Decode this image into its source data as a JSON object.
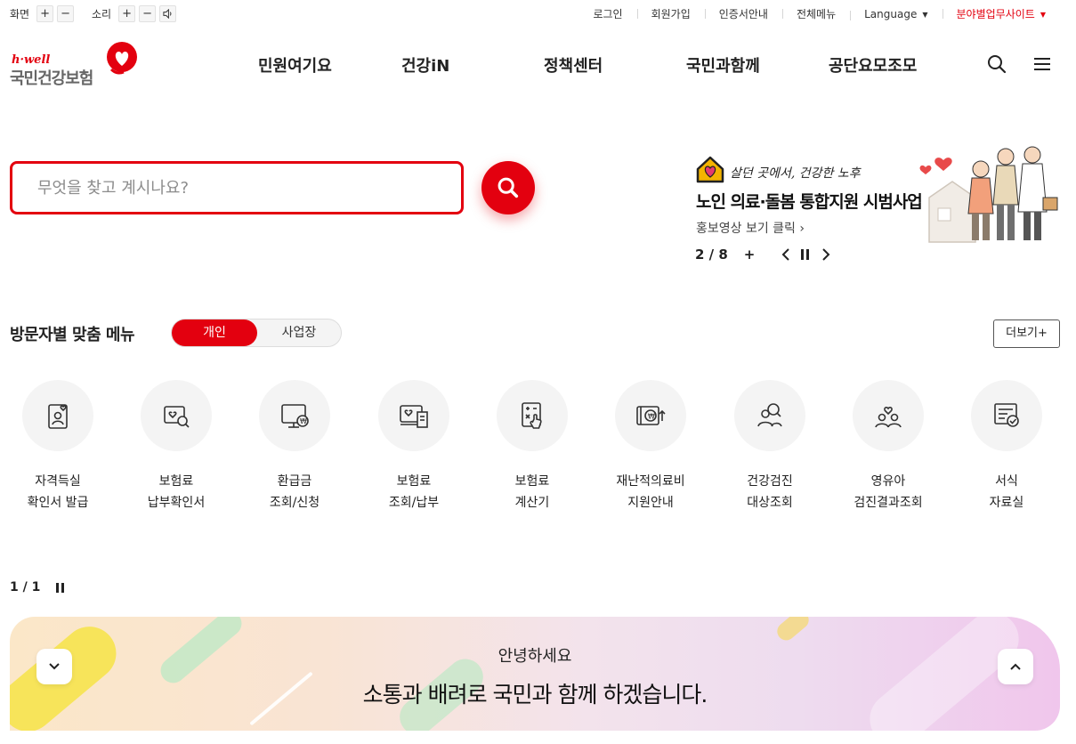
{
  "utility": {
    "screen_label": "화면",
    "sound_label": "소리",
    "plus": "+",
    "minus": "−",
    "links": [
      "로그인",
      "회원가입",
      "인증서안내",
      "전체메뉴",
      "Language",
      "분야별업무사이트"
    ]
  },
  "logo": {
    "top": "h·well",
    "name": "국민건강보험"
  },
  "gnb": [
    "민원여기요",
    "건강iN",
    "정책센터",
    "국민과함께",
    "공단요모조모"
  ],
  "search": {
    "placeholder": "무엇을 찾고 계시나요?"
  },
  "banner": {
    "subtitle": "살던 곳에서, 건강한 노후",
    "title": "노인 의료·돌봄 통합지원 시범사업",
    "link": "홍보영상 보기 클릭",
    "pager": "2 / 8"
  },
  "visitor": {
    "title": "방문자별 맞춤 메뉴",
    "tab_personal": "개인",
    "tab_business": "사업장",
    "more": "더보기+",
    "items": [
      {
        "line1": "자격득실",
        "line2": "확인서 발급",
        "icon": "id-card-heart-icon"
      },
      {
        "line1": "보험료",
        "line2": "납부확인서",
        "icon": "heart-search-icon"
      },
      {
        "line1": "환급금",
        "line2": "조회/신청",
        "icon": "monitor-won-icon"
      },
      {
        "line1": "보험료",
        "line2": "조회/납부",
        "icon": "screen-receipt-icon"
      },
      {
        "line1": "보험료",
        "line2": "계산기",
        "icon": "calculator-hand-icon"
      },
      {
        "line1": "재난적의료비",
        "line2": "지원안내",
        "icon": "wallet-won-icon"
      },
      {
        "line1": "건강검진",
        "line2": "대상조회",
        "icon": "people-search-icon"
      },
      {
        "line1": "영유아",
        "line2": "검진결과조회",
        "icon": "family-heart-icon"
      },
      {
        "line1": "서식",
        "line2": "자료실",
        "icon": "document-check-icon"
      }
    ],
    "pager": "1 / 1"
  },
  "greeting": {
    "hello": "안녕하세요",
    "message": "소통과 배려로 국민과 함께 하겠습니다."
  },
  "colors": {
    "brand_red": "#e3000f"
  }
}
